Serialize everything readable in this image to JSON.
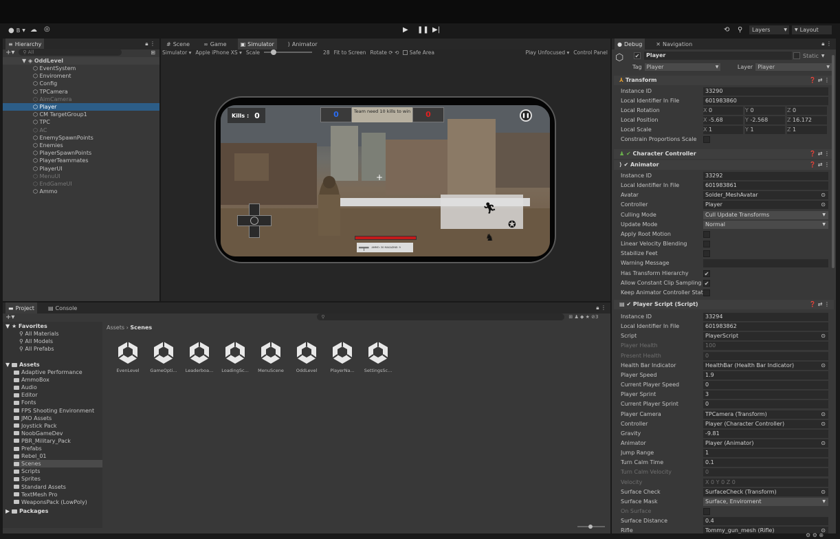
{
  "toolbar": {
    "account_label": "B",
    "play_icon": "play-icon",
    "pause_icon": "pause-icon",
    "step_icon": "step-icon",
    "layers_label": "Layers",
    "layout_label": "Layout"
  },
  "hierarchy": {
    "tab_label": "Hierarchy",
    "search_placeholder": "All",
    "scene_name": "OddLevel",
    "items": [
      {
        "label": "EventSystem",
        "dim": false,
        "selected": false
      },
      {
        "label": "Enviroment",
        "dim": false,
        "selected": false
      },
      {
        "label": "Config",
        "dim": false,
        "selected": false
      },
      {
        "label": "TPCamera",
        "dim": false,
        "selected": false
      },
      {
        "label": "AimCamera",
        "dim": true,
        "selected": false
      },
      {
        "label": "Player",
        "dim": false,
        "selected": true
      },
      {
        "label": "CM TargetGroup1",
        "dim": false,
        "selected": false
      },
      {
        "label": "TPC",
        "dim": false,
        "selected": false
      },
      {
        "label": "AC",
        "dim": true,
        "selected": false
      },
      {
        "label": "EnemySpawnPoints",
        "dim": false,
        "selected": false
      },
      {
        "label": "Enemies",
        "dim": false,
        "selected": false
      },
      {
        "label": "PlayerSpawnPoints",
        "dim": false,
        "selected": false
      },
      {
        "label": "PlayerTeammates",
        "dim": false,
        "selected": false
      },
      {
        "label": "PlayerUI",
        "dim": false,
        "selected": false
      },
      {
        "label": "MenuUI",
        "dim": true,
        "selected": false
      },
      {
        "label": "EndGameUI",
        "dim": true,
        "selected": false
      },
      {
        "label": "Ammo",
        "dim": false,
        "selected": false
      }
    ]
  },
  "center": {
    "tabs": [
      "Scene",
      "Game",
      "Simulator",
      "Animator"
    ],
    "active_tab": "Simulator",
    "sim_mode": "Simulator",
    "device": "Apple iPhone XS",
    "scale_label": "Scale",
    "scale_value": "28",
    "fit_label": "Fit to Screen",
    "rotate_label": "Rotate",
    "safe_area_label": "Safe Area",
    "play_mode": "Play Unfocused",
    "control_panel": "Control Panel"
  },
  "game": {
    "kills_label": "Kills :",
    "kills_value": "0",
    "team_score_blue": "0",
    "team_score_red": "0",
    "objective": "Team need 10 kills to win",
    "ammo_text": "AMMO: 30 MAGAZINE: 9"
  },
  "inspector": {
    "tabs": [
      "Debug",
      "Navigation"
    ],
    "object_name": "Player",
    "static_label": "Static",
    "tag_label": "Tag",
    "tag_value": "Player",
    "layer_label": "Layer",
    "layer_value": "Player",
    "transform": {
      "header": "Transform",
      "instance_id": "33290",
      "local_id": "601983860",
      "rotation": [
        "0",
        "0",
        "0"
      ],
      "position": [
        "-5.68",
        "-2.568",
        "16.172"
      ],
      "scale": [
        "1",
        "1",
        "1"
      ],
      "labels": [
        "Instance ID",
        "Local Identifier In File",
        "Local Rotation",
        "Local Position",
        "Local Scale",
        "Constrain Proportions Scale"
      ]
    },
    "character_controller": "Character Controller",
    "animator": {
      "header": "Animator",
      "rows": [
        {
          "label": "Instance ID",
          "value": "33292",
          "kind": "val"
        },
        {
          "label": "Local Identifier In File",
          "value": "601983861",
          "kind": "val"
        },
        {
          "label": "Avatar",
          "value": "Solder_MeshAvatar",
          "kind": "ref"
        },
        {
          "label": "Controller",
          "value": "Player",
          "kind": "ref"
        },
        {
          "label": "Culling Mode",
          "value": "Cull Update Transforms",
          "kind": "drop"
        },
        {
          "label": "Update Mode",
          "value": "Normal",
          "kind": "drop"
        },
        {
          "label": "Apply Root Motion",
          "value": "",
          "kind": "chk"
        },
        {
          "label": "Linear Velocity Blending",
          "value": "",
          "kind": "chk"
        },
        {
          "label": "Stabilize Feet",
          "value": "",
          "kind": "chk"
        },
        {
          "label": "Warning Message",
          "value": "",
          "kind": "val"
        },
        {
          "label": "Has Transform Hierarchy",
          "value": "✔",
          "kind": "chk"
        },
        {
          "label": "Allow Constant Clip Sampling",
          "value": "✔",
          "kind": "chk"
        },
        {
          "label": "Keep Animator Controller State",
          "value": "",
          "kind": "chk"
        }
      ]
    },
    "player_script": {
      "header": "Player Script (Script)",
      "rows": [
        {
          "label": "Instance ID",
          "value": "33294",
          "kind": "val",
          "dim": false
        },
        {
          "label": "Local Identifier In File",
          "value": "601983862",
          "kind": "val",
          "dim": false
        },
        {
          "label": "Script",
          "value": "PlayerScript",
          "kind": "ref",
          "dim": false
        },
        {
          "label": "Player Health",
          "value": "100",
          "kind": "val",
          "dim": true
        },
        {
          "label": "Present Health",
          "value": "0",
          "kind": "val",
          "dim": true
        },
        {
          "label": "Health Bar Indicator",
          "value": "HealthBar (Health Bar Indicator)",
          "kind": "ref",
          "dim": false
        },
        {
          "label": "Player Speed",
          "value": "1.9",
          "kind": "val",
          "dim": false
        },
        {
          "label": "Current Player Speed",
          "value": "0",
          "kind": "val",
          "dim": false
        },
        {
          "label": "Player Sprint",
          "value": "3",
          "kind": "val",
          "dim": false
        },
        {
          "label": "Current Player Sprint",
          "value": "0",
          "kind": "val",
          "dim": false
        },
        {
          "label": "Player Camera",
          "value": "TPCamera (Transform)",
          "kind": "ref",
          "dim": false
        },
        {
          "label": "Controller",
          "value": "Player (Character Controller)",
          "kind": "ref",
          "dim": false
        },
        {
          "label": "Gravity",
          "value": "-9.81",
          "kind": "val",
          "dim": false
        },
        {
          "label": "Animator",
          "value": "Player (Animator)",
          "kind": "ref",
          "dim": false
        },
        {
          "label": "Jump Range",
          "value": "1",
          "kind": "val",
          "dim": false
        },
        {
          "label": "Turn Calm Time",
          "value": "0.1",
          "kind": "val",
          "dim": false
        },
        {
          "label": "Turn Calm Velocity",
          "value": "0",
          "kind": "val",
          "dim": true
        },
        {
          "label": "Velocity",
          "value": "X 0          Y 0          Z 0",
          "kind": "val",
          "dim": true
        },
        {
          "label": "Surface Check",
          "value": "SurfaceCheck (Transform)",
          "kind": "ref",
          "dim": false
        },
        {
          "label": "Surface Mask",
          "value": "Surface, Enviroment",
          "kind": "drop",
          "dim": false
        },
        {
          "label": "On Surface",
          "value": "",
          "kind": "chk",
          "dim": true
        },
        {
          "label": "Surface Distance",
          "value": "0.4",
          "kind": "val",
          "dim": false
        },
        {
          "label": "Rifle",
          "value": "Tommy_gun_mesh (Rifle)",
          "kind": "ref",
          "dim": false
        }
      ]
    }
  },
  "project": {
    "tabs": [
      "Project",
      "Console"
    ],
    "favorites_label": "Favorites",
    "favorites": [
      "All Materials",
      "All Models",
      "All Prefabs"
    ],
    "assets_label": "Assets",
    "folders": [
      "Adaptive Performance",
      "AmmoBox",
      "Audio",
      "Editor",
      "Fonts",
      "FPS Shooting Environment",
      "JMO Assets",
      "Joystick Pack",
      "NoobGameDev",
      "PBR_Military_Pack",
      "Prefabs",
      "Rebel_01",
      "Scenes",
      "Scripts",
      "Sprites",
      "Standard Assets",
      "TextMesh Pro",
      "WeaponsPack (LowPoly)"
    ],
    "packages_label": "Packages",
    "breadcrumb_root": "Assets",
    "breadcrumb_leaf": "Scenes",
    "hidden_count": "3",
    "assets": [
      "EvenLevel",
      "GameOpti...",
      "Leaderboa...",
      "LoadingSc...",
      "MenuScene",
      "OddLevel",
      "PlayerNa...",
      "SettingsSc..."
    ]
  }
}
